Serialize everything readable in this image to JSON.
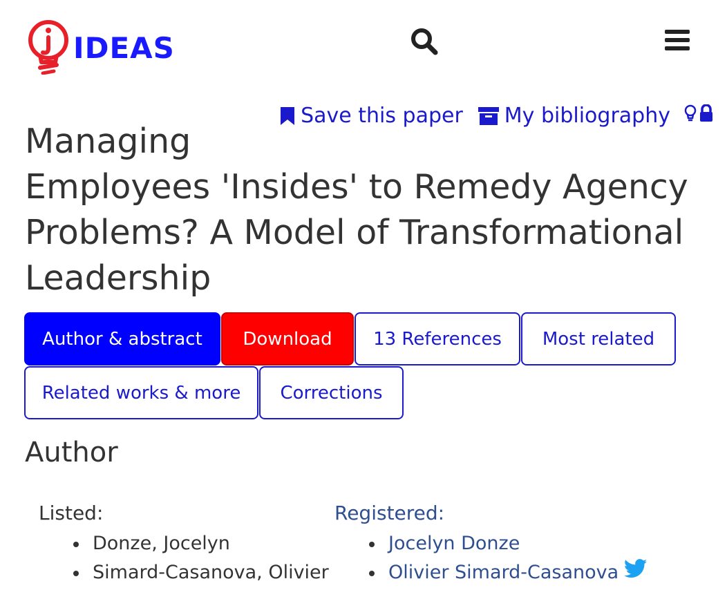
{
  "header": {
    "logo_text": "IDEAS",
    "logo_icon": "lightbulb-icon",
    "search_icon": "search-icon",
    "menu_icon": "hamburger-menu-icon"
  },
  "actions": {
    "save_label": "Save this paper",
    "bibliography_label": "My bibliography",
    "save_icon": "bookmark-icon",
    "bibliography_icon": "archive-box-icon",
    "lightbulb_icon": "lightbulb-outline-icon",
    "lock_icon": "lock-icon"
  },
  "paper": {
    "title_line1": "Managing",
    "title_line2": "Employees 'Insides' to Remedy Agency",
    "title_line3": "Problems? A Model of Transformational",
    "title_line4": "Leadership"
  },
  "tabs": [
    {
      "label": "Author & abstract",
      "active": true
    },
    {
      "label": "Download",
      "active": false
    },
    {
      "label": "13 References",
      "active": false
    },
    {
      "label": "Most related",
      "active": false
    },
    {
      "label": "Related works & more",
      "active": false
    },
    {
      "label": "Corrections",
      "active": false
    }
  ],
  "author_section": {
    "heading": "Author",
    "listed_label": "Listed:",
    "registered_label": "Registered:",
    "listed": [
      "Donze, Jocelyn",
      "Simard-Casanova, Olivier"
    ],
    "registered": [
      "Jocelyn Donze",
      "Olivier Simard-Casanova"
    ],
    "twitter_icon": "twitter-icon"
  },
  "colors": {
    "brand_blue": "#1a1aff",
    "link_blue": "#1a1acc",
    "active_tab": "#0000ff",
    "download_red": "#ff0000",
    "logo_red": "#e8202a",
    "registered_blue": "#2e4e8f",
    "twitter_blue": "#1da1f2",
    "text": "#333333"
  }
}
